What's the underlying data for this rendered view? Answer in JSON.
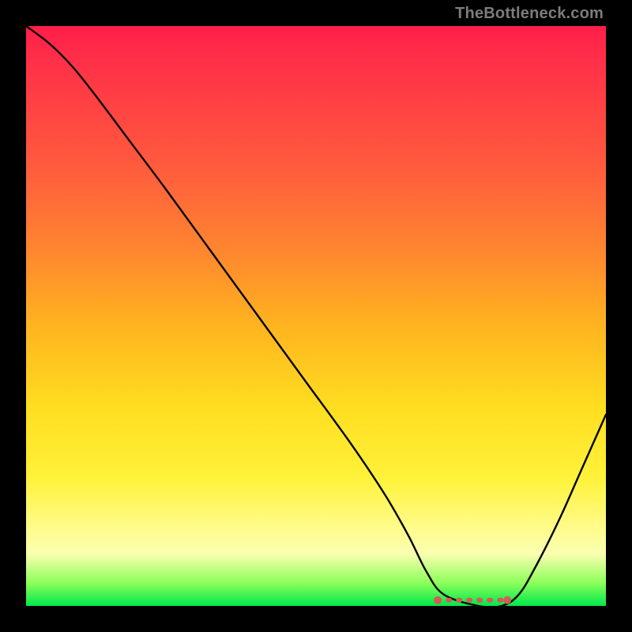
{
  "watermark": "TheBottleneck.com",
  "colors": {
    "curve": "#000000",
    "dots": "#d65a58",
    "frame": "#000000"
  },
  "chart_data": {
    "type": "line",
    "title": "",
    "xlabel": "",
    "ylabel": "",
    "xlim": [
      0,
      100
    ],
    "ylim": [
      0,
      100
    ],
    "note": "y = bottleneck percentage (0 at bottom = optimal). x = relative component performance. Values estimated from pixels.",
    "series": [
      {
        "name": "bottleneck-curve",
        "x": [
          0,
          4,
          8,
          12,
          18,
          24,
          32,
          40,
          48,
          56,
          62,
          66,
          69,
          72,
          78,
          82,
          85,
          88,
          92,
          96,
          100
        ],
        "y": [
          100,
          97,
          93,
          88,
          80,
          72,
          61,
          50,
          39,
          28,
          19,
          12,
          6,
          2,
          0,
          0,
          2,
          7,
          15,
          24,
          33
        ]
      }
    ],
    "optimal_range": {
      "x_start": 71,
      "x_end": 83,
      "y": 1
    }
  }
}
